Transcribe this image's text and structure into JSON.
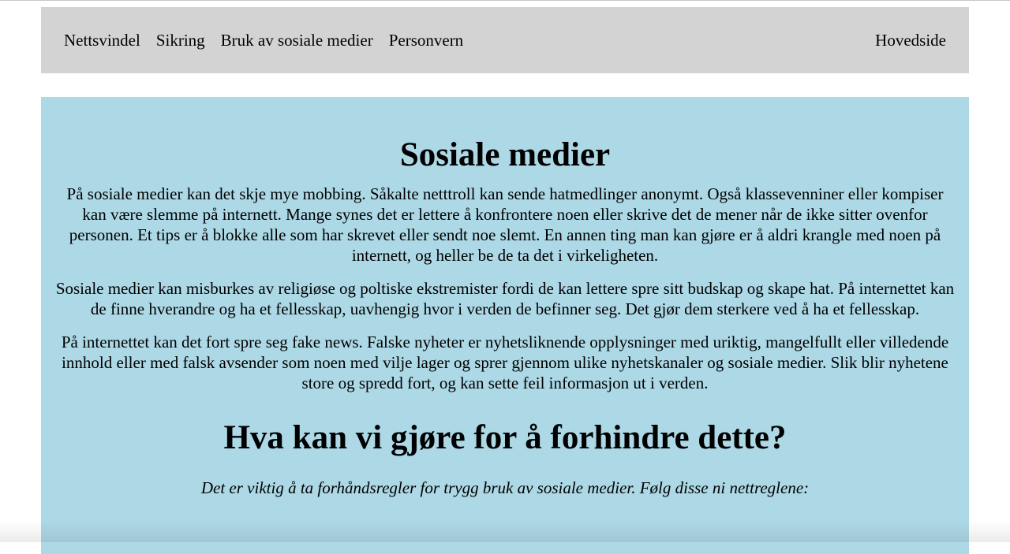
{
  "nav": {
    "links": [
      {
        "label": "Nettsvindel"
      },
      {
        "label": "Sikring"
      },
      {
        "label": "Bruk av sosiale medier"
      },
      {
        "label": "Personvern"
      }
    ],
    "home_label": "Hovedside"
  },
  "main": {
    "title": "Sosiale medier",
    "paragraphs": [
      "På sosiale medier kan det skje mye mobbing. Såkalte netttroll kan sende hatmedlinger anonymt. Også klassevenniner eller kompiser kan være slemme på internett. Mange synes det er lettere å konfrontere noen eller skrive det de mener når de ikke sitter ovenfor personen. Et tips er å blokke alle som har skrevet eller sendt noe slemt. En annen ting man kan gjøre er å aldri krangle med noen på internett, og heller be de ta det i virkeligheten.",
      "Sosiale medier kan misburkes av religiøse og poltiske ekstremister fordi de kan lettere spre sitt budskap og skape hat. På internettet kan de finne hverandre og ha et fellesskap, uavhengig hvor i verden de befinner seg. Det gjør dem sterkere ved å ha et fellesskap.",
      "På internettet kan det fort spre seg fake news. Falske nyheter er nyhetsliknende opplysninger med uriktig, mangelfullt eller villedende innhold eller med falsk avsender som noen med vilje lager og sprer gjennom ulike nyhetskanaler og sosiale medier. Slik blir nyhetene store og spredd fort, og kan sette feil informasjon ut i verden."
    ],
    "subtitle": "Hva kan vi gjøre for å forhindre dette?",
    "intro": "Det er viktig å ta forhåndsregler for trygg bruk av sosiale medier. Følg disse ni nettreglene:"
  },
  "colors": {
    "nav_background": "#d3d3d3",
    "content_background": "#add8e6",
    "page_background": "#ffffff"
  }
}
